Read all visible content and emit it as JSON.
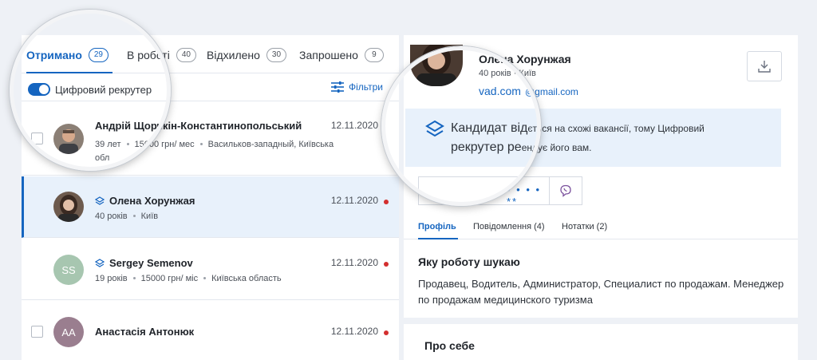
{
  "left_panel": {
    "tabs": [
      {
        "label": "Отримано",
        "count": "29"
      },
      {
        "label": "В роботі",
        "count": "40"
      },
      {
        "label": "Відхилено",
        "count": "30"
      },
      {
        "label": "Запрошено",
        "count": "9"
      }
    ],
    "toggle_label": "Цифровий рекрутер",
    "filters_label": "Фільтри",
    "candidates": [
      {
        "name": "Андрій Щорчкін-Константинопольський",
        "meta": [
          "39 лет",
          "15000 грн/ мес",
          "Васильков-западный, Київська"
        ],
        "extra": "обл",
        "date": "12.11.2020",
        "initials": ""
      },
      {
        "name": "Олена Хорунжая",
        "meta": [
          "40 років",
          "Київ"
        ],
        "date": "12.11.2020",
        "initials": ""
      },
      {
        "name": "Sergey Semenov",
        "meta": [
          "19 років",
          "15000 грн/ міс",
          "Київська область"
        ],
        "date": "12.11.2020",
        "initials": "SS"
      },
      {
        "name": "Анастасія Антонюк",
        "meta": [],
        "date": "12.11.2020",
        "initials": "АА"
      }
    ]
  },
  "right_panel": {
    "name": "Олена Хорунжая",
    "age": "40 років",
    "city": "Київ",
    "contact_short": "vad.com",
    "email": "@gmail.com",
    "banner_line1_big": "Кандидат від",
    "banner_line1_small": "ється на схожі вакансії, тому Цифровий",
    "banner_line2_big": "рекрутер ре",
    "banner_line2_small": "ендує його вам.",
    "phone_masked": "• • • • **",
    "tabs": [
      "Профіль",
      "Повідомлення (4)",
      "Нотатки (2)"
    ],
    "section1_title": "Яку роботу шукаю",
    "section1_text": "Продавец, Водитель, Администратор, Специалист по продажам. Менеджер по продажам медицинского туризма",
    "section2_title": "Про себе"
  },
  "colors": {
    "accent": "#1565c0",
    "unread": "#d32f2f",
    "selected_row": "#e8f1fb",
    "banner": "#e8f1fb"
  }
}
